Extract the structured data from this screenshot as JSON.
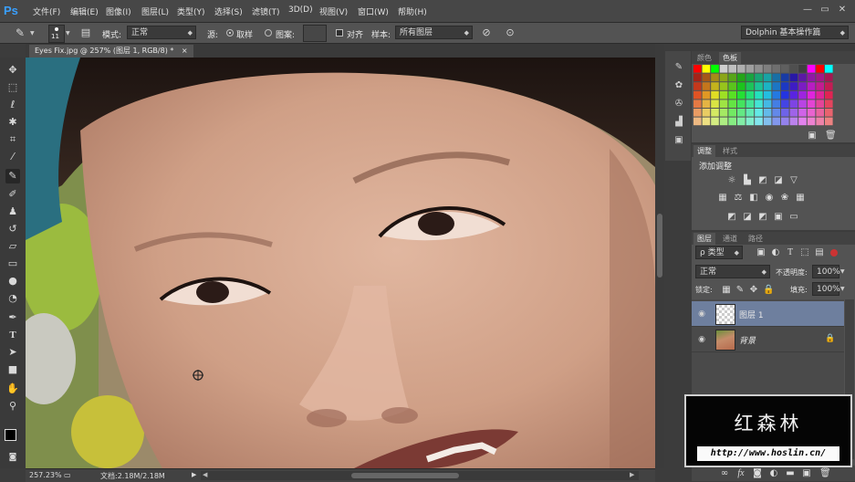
{
  "app": {
    "logo": "Ps"
  },
  "menu": [
    "文件(F)",
    "编辑(E)",
    "图像(I)",
    "图层(L)",
    "类型(Y)",
    "选择(S)",
    "滤镜(T)",
    "3D(D)",
    "视图(V)",
    "窗口(W)",
    "帮助(H)"
  ],
  "window_controls": {
    "minimize": "—",
    "restore": "▭",
    "close": "✕"
  },
  "options": {
    "brush_size": "11",
    "mode_label": "模式:",
    "mode_value": "正常",
    "source_label": "源:",
    "sampled_label": "取样",
    "pattern_label": "图案:",
    "aligned_label": "对齐",
    "sample_label": "样本:",
    "sample_value": "所有图层",
    "workspace": "Dolphin 基本操作篇"
  },
  "document_tab": {
    "title": "Eyes Fix.jpg @ 257% (图层 1, RGB/8) *",
    "close": "×"
  },
  "swatches_panel": {
    "tabs": [
      "颜色",
      "色板"
    ],
    "active": 1
  },
  "adjustments_panel": {
    "tabs": [
      "调整",
      "样式"
    ],
    "active": 0,
    "heading": "添加调整"
  },
  "layers_panel": {
    "tabs": [
      "图层",
      "通道",
      "路径"
    ],
    "active": 0,
    "filter_type": "类型",
    "blend_mode": "正常",
    "opacity_label": "不透明度:",
    "opacity_value": "100%",
    "lock_label": "锁定:",
    "fill_label": "填充:",
    "fill_value": "100%",
    "layers": [
      {
        "name": "图层 1",
        "selected": true,
        "visible": true
      },
      {
        "name": "背景",
        "selected": false,
        "visible": true,
        "locked": true
      }
    ]
  },
  "status": {
    "zoom": "257.23%",
    "doc_info": "文档:2.18M/2.18M"
  },
  "watermark": {
    "title": "红森林",
    "url": "http://www.hoslin.cn/"
  },
  "colors": {
    "accent": "#3aa0ff",
    "selected_layer": "#6e7f9e"
  }
}
